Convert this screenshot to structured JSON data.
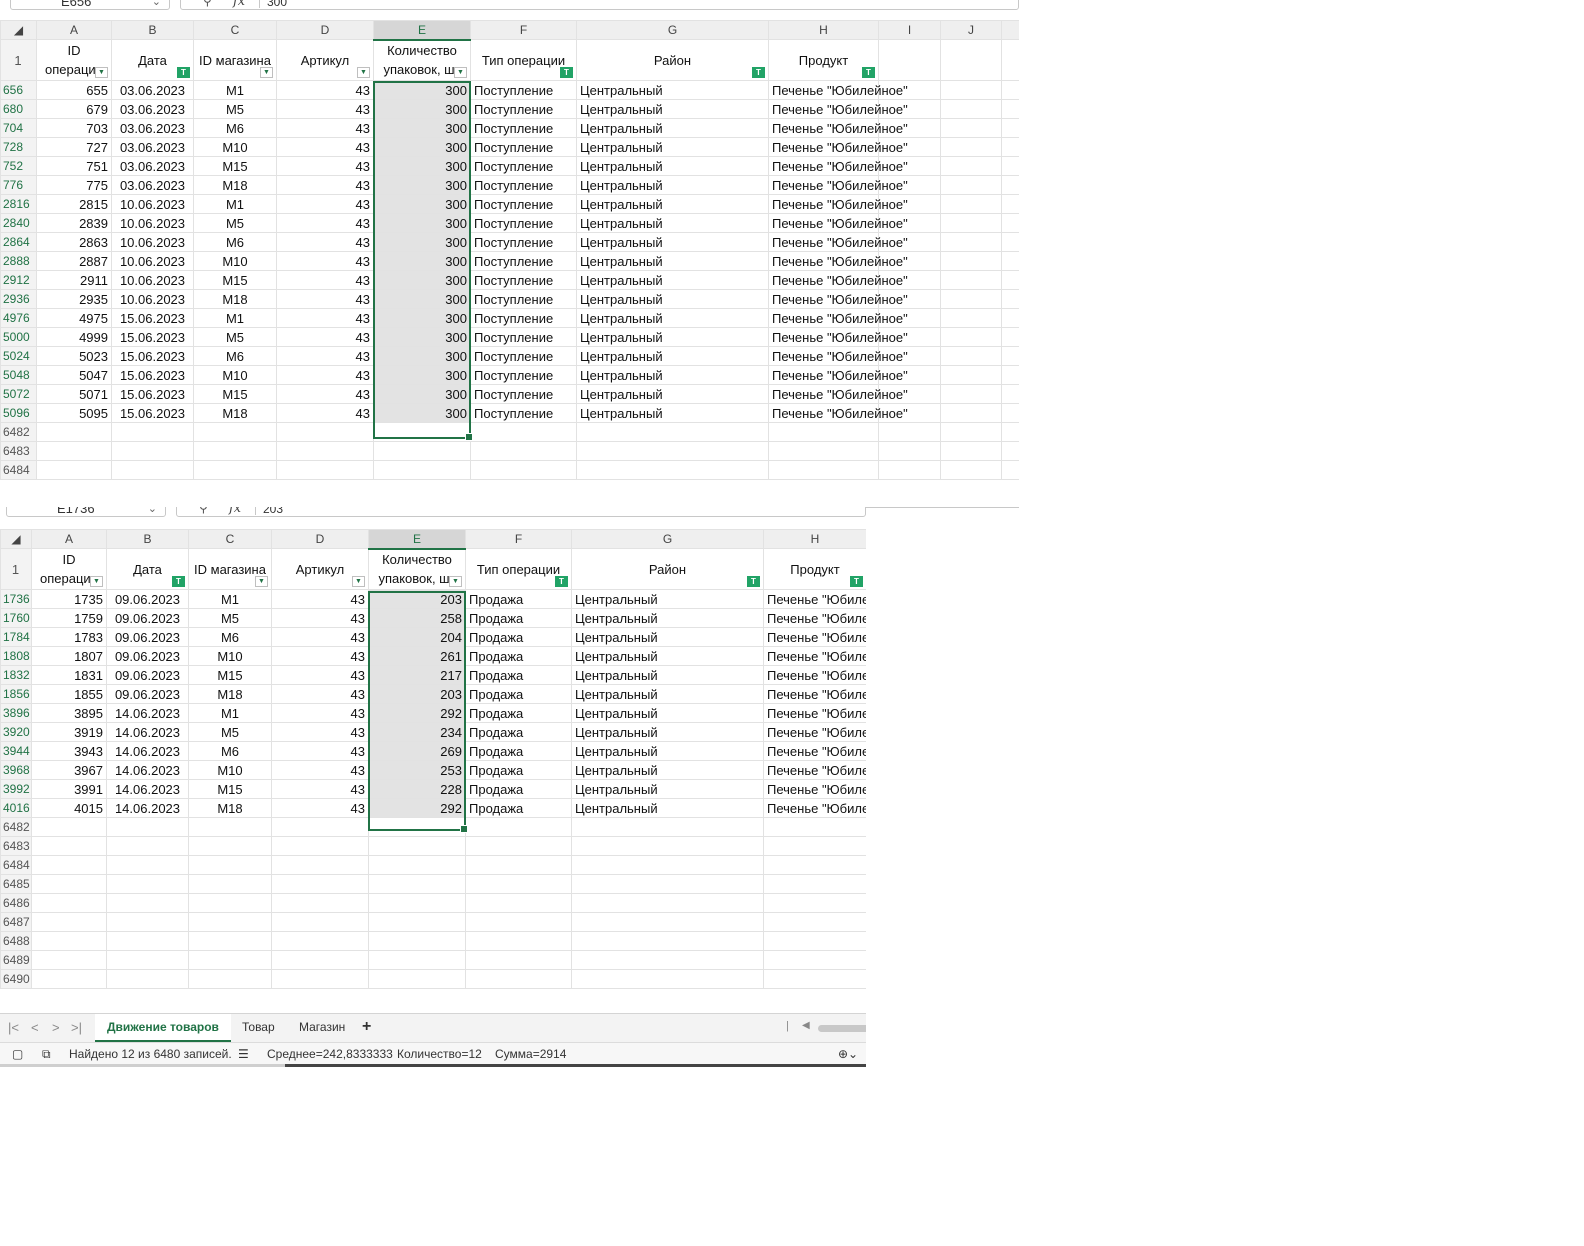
{
  "top_pane": {
    "name_box": "E656",
    "formula_value": "300",
    "columns": [
      "A",
      "B",
      "C",
      "D",
      "E",
      "F",
      "G",
      "H",
      "I",
      "J"
    ],
    "selected_column": "E",
    "header_row_number": "1",
    "headers": [
      "ID операции",
      "Дата",
      "ID магазина",
      "Артикул",
      "Количество упаковок, шт",
      "Тип операции",
      "Район",
      "Продукт"
    ],
    "header_filters": [
      "dropdown",
      "filtered",
      "dropdown",
      "dropdown",
      "dropdown",
      "filtered",
      "filtered",
      "filtered"
    ],
    "rows": [
      {
        "rn": "656",
        "id": "655",
        "date": "03.06.2023",
        "store": "М1",
        "art": "43",
        "qty": "300",
        "type": "Поступление",
        "district": "Центральный",
        "product": "Печенье \"Юбилейное\""
      },
      {
        "rn": "680",
        "id": "679",
        "date": "03.06.2023",
        "store": "М5",
        "art": "43",
        "qty": "300",
        "type": "Поступление",
        "district": "Центральный",
        "product": "Печенье \"Юбилейное\""
      },
      {
        "rn": "704",
        "id": "703",
        "date": "03.06.2023",
        "store": "М6",
        "art": "43",
        "qty": "300",
        "type": "Поступление",
        "district": "Центральный",
        "product": "Печенье \"Юбилейное\""
      },
      {
        "rn": "728",
        "id": "727",
        "date": "03.06.2023",
        "store": "М10",
        "art": "43",
        "qty": "300",
        "type": "Поступление",
        "district": "Центральный",
        "product": "Печенье \"Юбилейное\""
      },
      {
        "rn": "752",
        "id": "751",
        "date": "03.06.2023",
        "store": "М15",
        "art": "43",
        "qty": "300",
        "type": "Поступление",
        "district": "Центральный",
        "product": "Печенье \"Юбилейное\""
      },
      {
        "rn": "776",
        "id": "775",
        "date": "03.06.2023",
        "store": "М18",
        "art": "43",
        "qty": "300",
        "type": "Поступление",
        "district": "Центральный",
        "product": "Печенье \"Юбилейное\""
      },
      {
        "rn": "2816",
        "id": "2815",
        "date": "10.06.2023",
        "store": "М1",
        "art": "43",
        "qty": "300",
        "type": "Поступление",
        "district": "Центральный",
        "product": "Печенье \"Юбилейное\""
      },
      {
        "rn": "2840",
        "id": "2839",
        "date": "10.06.2023",
        "store": "М5",
        "art": "43",
        "qty": "300",
        "type": "Поступление",
        "district": "Центральный",
        "product": "Печенье \"Юбилейное\""
      },
      {
        "rn": "2864",
        "id": "2863",
        "date": "10.06.2023",
        "store": "М6",
        "art": "43",
        "qty": "300",
        "type": "Поступление",
        "district": "Центральный",
        "product": "Печенье \"Юбилейное\""
      },
      {
        "rn": "2888",
        "id": "2887",
        "date": "10.06.2023",
        "store": "М10",
        "art": "43",
        "qty": "300",
        "type": "Поступление",
        "district": "Центральный",
        "product": "Печенье \"Юбилейное\""
      },
      {
        "rn": "2912",
        "id": "2911",
        "date": "10.06.2023",
        "store": "М15",
        "art": "43",
        "qty": "300",
        "type": "Поступление",
        "district": "Центральный",
        "product": "Печенье \"Юбилейное\""
      },
      {
        "rn": "2936",
        "id": "2935",
        "date": "10.06.2023",
        "store": "М18",
        "art": "43",
        "qty": "300",
        "type": "Поступление",
        "district": "Центральный",
        "product": "Печенье \"Юбилейное\""
      },
      {
        "rn": "4976",
        "id": "4975",
        "date": "15.06.2023",
        "store": "М1",
        "art": "43",
        "qty": "300",
        "type": "Поступление",
        "district": "Центральный",
        "product": "Печенье \"Юбилейное\""
      },
      {
        "rn": "5000",
        "id": "4999",
        "date": "15.06.2023",
        "store": "М5",
        "art": "43",
        "qty": "300",
        "type": "Поступление",
        "district": "Центральный",
        "product": "Печенье \"Юбилейное\""
      },
      {
        "rn": "5024",
        "id": "5023",
        "date": "15.06.2023",
        "store": "М6",
        "art": "43",
        "qty": "300",
        "type": "Поступление",
        "district": "Центральный",
        "product": "Печенье \"Юбилейное\""
      },
      {
        "rn": "5048",
        "id": "5047",
        "date": "15.06.2023",
        "store": "М10",
        "art": "43",
        "qty": "300",
        "type": "Поступление",
        "district": "Центральный",
        "product": "Печенье \"Юбилейное\""
      },
      {
        "rn": "5072",
        "id": "5071",
        "date": "15.06.2023",
        "store": "М15",
        "art": "43",
        "qty": "300",
        "type": "Поступление",
        "district": "Центральный",
        "product": "Печенье \"Юбилейное\""
      },
      {
        "rn": "5096",
        "id": "5095",
        "date": "15.06.2023",
        "store": "М18",
        "art": "43",
        "qty": "300",
        "type": "Поступление",
        "district": "Центральный",
        "product": "Печенье \"Юбилейное\""
      }
    ],
    "empty_rows": [
      "6482",
      "6483",
      "6484"
    ]
  },
  "bottom_pane": {
    "name_box": "E1736",
    "formula_value": "203",
    "columns": [
      "A",
      "B",
      "C",
      "D",
      "E",
      "F",
      "G",
      "H"
    ],
    "selected_column": "E",
    "header_row_number": "1",
    "headers": [
      "ID операции",
      "Дата",
      "ID магазина",
      "Артикул",
      "Количество упаковок, шт",
      "Тип операции",
      "Район",
      "Продукт"
    ],
    "header_filters": [
      "dropdown",
      "filtered",
      "dropdown",
      "dropdown",
      "dropdown",
      "filtered",
      "filtered",
      "filtered"
    ],
    "rows": [
      {
        "rn": "1736",
        "id": "1735",
        "date": "09.06.2023",
        "store": "М1",
        "art": "43",
        "qty": "203",
        "type": "Продажа",
        "district": "Центральный",
        "product": "Печенье \"Юбиле"
      },
      {
        "rn": "1760",
        "id": "1759",
        "date": "09.06.2023",
        "store": "М5",
        "art": "43",
        "qty": "258",
        "type": "Продажа",
        "district": "Центральный",
        "product": "Печенье \"Юбиле"
      },
      {
        "rn": "1784",
        "id": "1783",
        "date": "09.06.2023",
        "store": "М6",
        "art": "43",
        "qty": "204",
        "type": "Продажа",
        "district": "Центральный",
        "product": "Печенье \"Юбиле"
      },
      {
        "rn": "1808",
        "id": "1807",
        "date": "09.06.2023",
        "store": "М10",
        "art": "43",
        "qty": "261",
        "type": "Продажа",
        "district": "Центральный",
        "product": "Печенье \"Юбиле"
      },
      {
        "rn": "1832",
        "id": "1831",
        "date": "09.06.2023",
        "store": "М15",
        "art": "43",
        "qty": "217",
        "type": "Продажа",
        "district": "Центральный",
        "product": "Печенье \"Юбиле"
      },
      {
        "rn": "1856",
        "id": "1855",
        "date": "09.06.2023",
        "store": "М18",
        "art": "43",
        "qty": "203",
        "type": "Продажа",
        "district": "Центральный",
        "product": "Печенье \"Юбиле"
      },
      {
        "rn": "3896",
        "id": "3895",
        "date": "14.06.2023",
        "store": "М1",
        "art": "43",
        "qty": "292",
        "type": "Продажа",
        "district": "Центральный",
        "product": "Печенье \"Юбиле"
      },
      {
        "rn": "3920",
        "id": "3919",
        "date": "14.06.2023",
        "store": "М5",
        "art": "43",
        "qty": "234",
        "type": "Продажа",
        "district": "Центральный",
        "product": "Печенье \"Юбиле"
      },
      {
        "rn": "3944",
        "id": "3943",
        "date": "14.06.2023",
        "store": "М6",
        "art": "43",
        "qty": "269",
        "type": "Продажа",
        "district": "Центральный",
        "product": "Печенье \"Юбиле"
      },
      {
        "rn": "3968",
        "id": "3967",
        "date": "14.06.2023",
        "store": "М10",
        "art": "43",
        "qty": "253",
        "type": "Продажа",
        "district": "Центральный",
        "product": "Печенье \"Юбиле"
      },
      {
        "rn": "3992",
        "id": "3991",
        "date": "14.06.2023",
        "store": "М15",
        "art": "43",
        "qty": "228",
        "type": "Продажа",
        "district": "Центральный",
        "product": "Печенье \"Юбиле"
      },
      {
        "rn": "4016",
        "id": "4015",
        "date": "14.06.2023",
        "store": "М18",
        "art": "43",
        "qty": "292",
        "type": "Продажа",
        "district": "Центральный",
        "product": "Печенье \"Юбиле"
      }
    ],
    "empty_rows": [
      "6482",
      "6483",
      "6484",
      "6485",
      "6486",
      "6487",
      "6488",
      "6489",
      "6490"
    ]
  },
  "sheet_tabs": [
    "Движение товаров",
    "Товар",
    "Магазин"
  ],
  "active_tab": "Движение товаров",
  "status": {
    "found": "Найдено 12 из 6480 записей.",
    "average": "Среднее=242,8333333",
    "count": "Количество=12",
    "sum": "Сумма=2914"
  },
  "colors": {
    "accent": "#217346",
    "filter_active": "#21a366",
    "row_number": "#207245",
    "selection_fill": "#e3e3e3"
  },
  "icons": [
    "search-icon",
    "fx-icon",
    "filter-dropdown-icon",
    "filter-active-icon",
    "first-sheet-icon",
    "prev-sheet-icon",
    "next-sheet-icon",
    "last-sheet-icon",
    "add-sheet-icon",
    "sheet-view-icon",
    "records-icon",
    "select-all-icon"
  ]
}
